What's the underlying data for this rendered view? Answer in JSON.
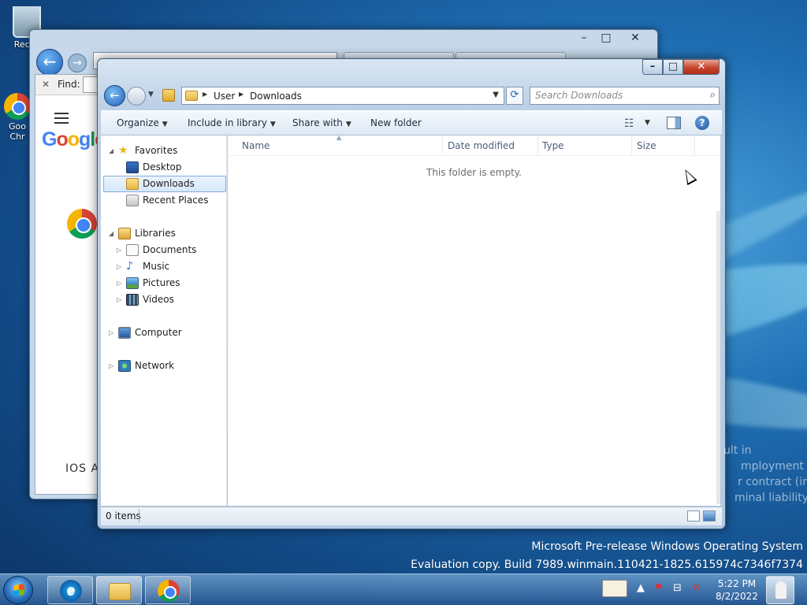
{
  "desktop": {
    "recycle_bin_label": "Recyc",
    "chrome_shortcut_label_1": "Goo",
    "chrome_shortcut_label_2": "Chr"
  },
  "browser": {
    "find_label": "Find:",
    "google_logo": "Google",
    "footer_text": "IOS A"
  },
  "explorer": {
    "window_controls": {
      "minimize": "–",
      "maximize": "□",
      "close": "✕"
    },
    "breadcrumb": [
      "User",
      "Downloads"
    ],
    "search_placeholder": "Search Downloads",
    "toolbar": {
      "organize": "Organize",
      "include_in_library": "Include in library",
      "share_with": "Share with",
      "new_folder": "New folder"
    },
    "nav": {
      "favorites": "Favorites",
      "desktop": "Desktop",
      "downloads": "Downloads",
      "recent_places": "Recent Places",
      "libraries": "Libraries",
      "documents": "Documents",
      "music": "Music",
      "pictures": "Pictures",
      "videos": "Videos",
      "computer": "Computer",
      "network": "Network"
    },
    "columns": {
      "name": "Name",
      "date_modified": "Date modified",
      "type": "Type",
      "size": "Size"
    },
    "empty_message": "This folder is empty.",
    "status_items": "0 items"
  },
  "legal_fragments": [
    "ult in",
    "mployment (in",
    "r contract (in",
    "minal liability."
  ],
  "watermark": {
    "line1": "Microsoft Pre-release Windows Operating System",
    "line2": "Evaluation copy. Build 7989.winmain.110421-1825.615974c7346f7374"
  },
  "taskbar": {
    "time": "5:22 PM",
    "date": "8/2/2022",
    "ie_glyph": "e"
  }
}
